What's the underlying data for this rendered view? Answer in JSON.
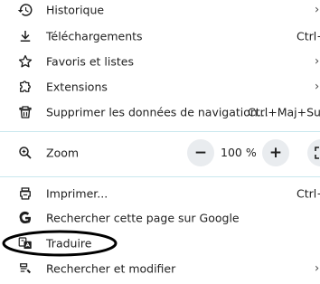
{
  "menu": {
    "items_top": [
      {
        "label": "Historique",
        "shortcut": "",
        "icon": "history-icon",
        "has_submenu": true
      },
      {
        "label": "Téléchargements",
        "shortcut": "Ctrl+",
        "icon": "download-icon",
        "has_submenu": false
      },
      {
        "label": "Favoris et listes",
        "shortcut": "",
        "icon": "star-icon",
        "has_submenu": true
      },
      {
        "label": "Extensions",
        "shortcut": "",
        "icon": "extension-icon",
        "has_submenu": true
      },
      {
        "label": "Supprimer les données de navigation...",
        "shortcut": "Ctrl+Maj+Supp",
        "icon": "trash-icon",
        "has_submenu": false
      }
    ],
    "zoom": {
      "label": "Zoom",
      "icon": "zoom-icon",
      "minus": "−",
      "value": "100 %",
      "plus": "+",
      "fullscreen_icon": "fullscreen-icon"
    },
    "items_bottom": [
      {
        "label": "Imprimer...",
        "shortcut": "Ctrl+",
        "icon": "print-icon",
        "has_submenu": false
      },
      {
        "label": "Rechercher cette page sur Google",
        "shortcut": "",
        "icon": "google-icon",
        "has_submenu": false
      },
      {
        "label": "Traduire",
        "shortcut": "",
        "icon": "translate-icon",
        "has_submenu": false
      },
      {
        "label": "Rechercher et modifier",
        "shortcut": "",
        "icon": "find-edit-icon",
        "has_submenu": true
      }
    ],
    "chevron": "›",
    "annotation_color": "#000000",
    "divider_color": "#c9e7ee"
  }
}
